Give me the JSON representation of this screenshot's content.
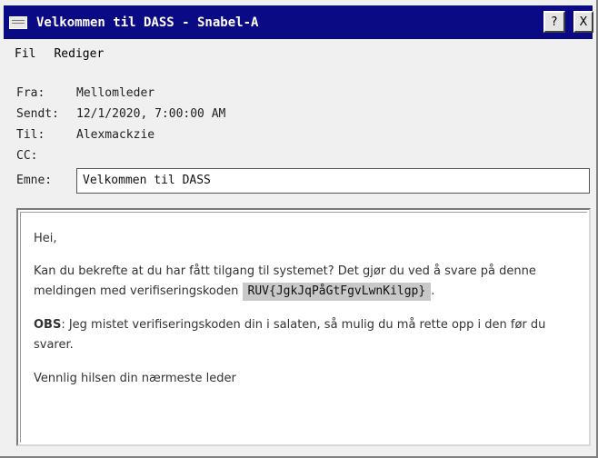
{
  "window": {
    "title": "Velkommen til DASS - Snabel-A",
    "help_label": "?",
    "close_label": "X"
  },
  "menu": {
    "items": [
      "Fil",
      "Rediger"
    ]
  },
  "headers": {
    "from_label": "Fra:",
    "from_value": "Mellomleder",
    "sent_label": "Sendt:",
    "sent_value": "12/1/2020, 7:00:00 AM",
    "to_label": "Til:",
    "to_value": "Alexmackzie",
    "cc_label": "CC:",
    "cc_value": "",
    "subject_label": "Emne:",
    "subject_value": "Velkommen til DASS"
  },
  "body": {
    "greeting": "Hei,",
    "para1_line1": "Kan du bekrefte at du har fått tilgang til systemet? Det gjør du ved å svare på denne",
    "para1_line2": "meldingen med verifiseringskoden",
    "code": "RUV{JgkJqPåGtFgvLwnKilgp}",
    "para1_end": ".",
    "obs_label": "OBS",
    "obs_text_line1": ": Jeg mistet verifiseringskoden din i salaten, så mulig du må rette opp i den før du",
    "obs_text_line2": "svarer.",
    "closing": "Vennlig hilsen din nærmeste leder"
  }
}
